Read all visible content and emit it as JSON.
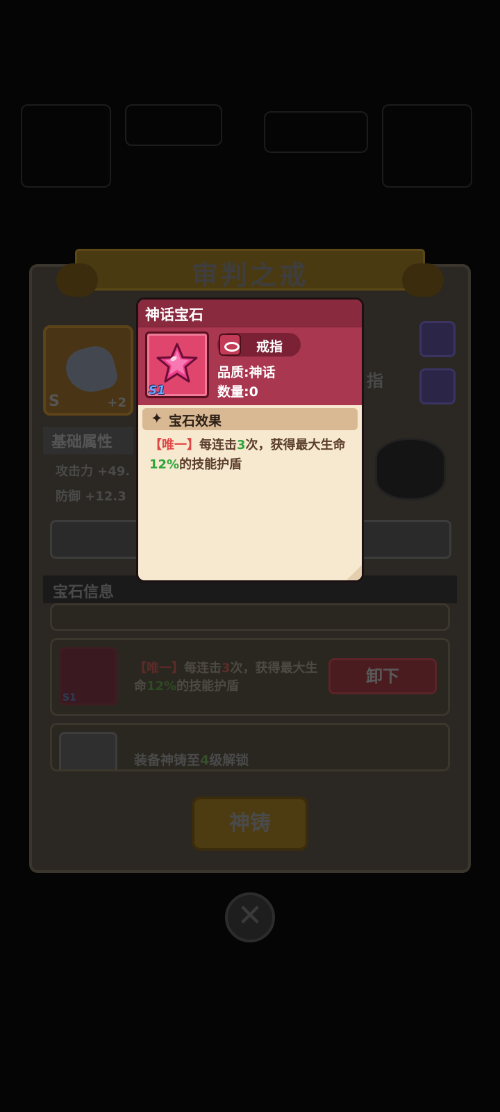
{
  "background": {
    "equip_title": "审判之戒",
    "item_grade": "S",
    "item_plus": "+2",
    "stats_header": "基础属性",
    "stats": [
      "攻击力 +49.",
      "防御 +12.3"
    ],
    "ring_tag": "指",
    "gem_info_header": "宝石信息",
    "equipped_gem": {
      "badge": "S1",
      "desc_prefix": "【唯一】",
      "desc_part1": "每连击",
      "desc_num1": "3",
      "desc_part2": "次，获得最大生命",
      "desc_pct": "12%",
      "desc_part3": "的技能护盾",
      "unequip_label": "卸下"
    },
    "locked_slot": {
      "text_before": "装备神铸至",
      "level": "4",
      "text_after": "级解锁"
    },
    "forge_label": "神铸",
    "close_glyph": "✕"
  },
  "popup": {
    "title": "神话宝石",
    "badge": "S1",
    "type_label": "戒指",
    "quality_line": "品质:神话",
    "count_line": "数量:0",
    "effect_header": "宝石效果",
    "effect_icon": "sparkle-icon",
    "effect": {
      "prefix": "【唯一】",
      "part1": "每连击",
      "num1": "3",
      "part2": "次，获得最大生命",
      "pct": "12%",
      "part3": "的技能护盾"
    }
  },
  "colors": {
    "popup_header": "#a8374f",
    "popup_body": "#f7e9d0",
    "accent_red": "#e24545",
    "accent_green": "#2ea53a"
  }
}
